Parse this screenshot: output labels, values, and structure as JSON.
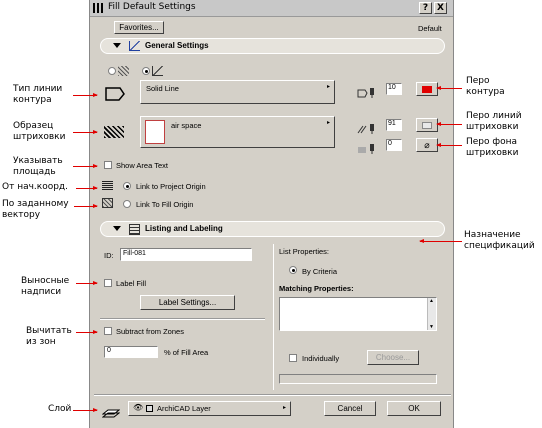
{
  "window": {
    "title": "Fill Default Settings",
    "help": "?",
    "close": "X"
  },
  "toolbar": {
    "favorites": "Favorites...",
    "default_label": "Default"
  },
  "general": {
    "title": "General Settings",
    "line_type": "Solid Line",
    "fill_type": "air space",
    "show_area_text": "Show Area Text",
    "link_project": "Link to Project Origin",
    "link_fill": "Link To Fill Origin",
    "contour_pen": "10",
    "hatch_pen": "91",
    "bg_pen": "0"
  },
  "listing": {
    "title": "Listing and Labeling",
    "id_label": "ID:",
    "id_value": "Fill-081",
    "label_fill": "Label Fill",
    "label_settings": "Label Settings...",
    "subtract": "Subtract from Zones",
    "percent_value": "0",
    "percent_label": "% of Fill Area",
    "list_props": "List Properties:",
    "by_criteria": "By Criteria",
    "matching": "Matching Properties:",
    "individually": "Individually",
    "choose": "Choose..."
  },
  "bottom": {
    "layer": "ArchiCAD Layer",
    "cancel": "Cancel",
    "ok": "OK"
  },
  "annotations": {
    "contour_type": "Тип линии контура",
    "hatch_sample": "Образец штриховки",
    "show_area": "Указывать площадь",
    "from_origin": "От нач.коорд.",
    "by_vector": "По заданному вектору",
    "callouts": "Выносные надписи",
    "subtract_zones": "Вычитать из зон",
    "layer": "Слой",
    "contour_pen": "Перо контура",
    "hatch_pen": "Перо линий штриховки",
    "bg_pen": "Перо фона штриховки",
    "spec": "Назначение спецификаций"
  },
  "colors": {
    "accent_red": "#e00000",
    "dialog_bg": "#d4d0c8",
    "pen_red": "#e00000"
  }
}
